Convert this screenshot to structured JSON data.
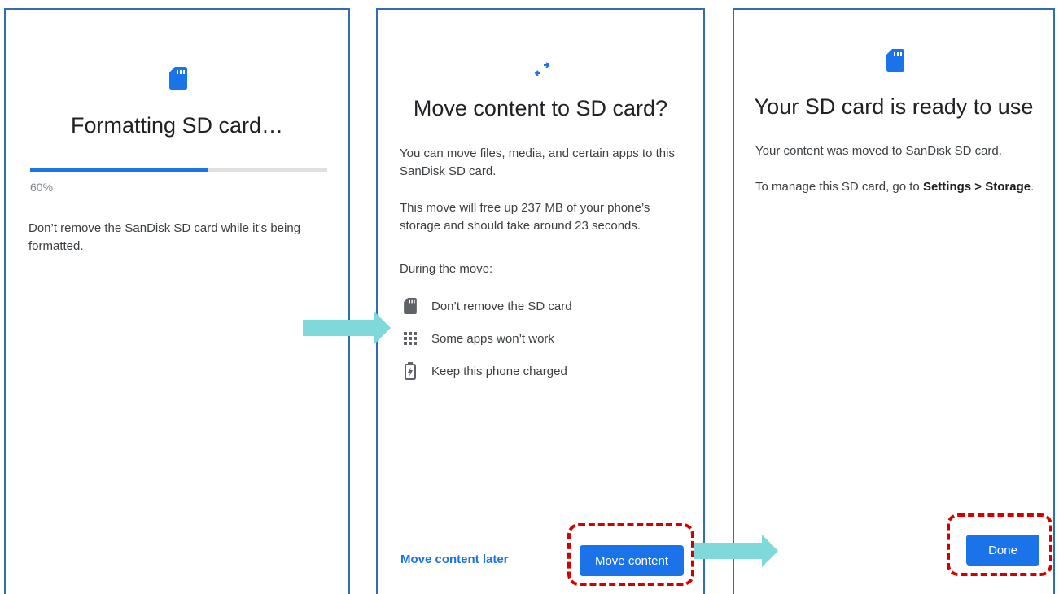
{
  "colors": {
    "accent": "#1a73e8",
    "panel_border": "#2e6fb4",
    "annotation": "#d40000",
    "arrow": "#7fd8d9"
  },
  "screen1": {
    "icon": "sd-card-icon",
    "title": "Formatting SD card…",
    "progress_percent": 60,
    "progress_label": "60%",
    "message": "Don’t remove the SanDisk SD card while it’s being formatted."
  },
  "screen2": {
    "icon": "swap-arrows-icon",
    "title": "Move content to SD card?",
    "intro": "You can move files, media, and certain apps to this SanDisk SD card.",
    "details": "This move will free up 237 MB of your phone’s storage and should take around 23 seconds.",
    "during_label": "During the move:",
    "bullets": [
      {
        "icon": "sd-card-icon",
        "text": "Don’t remove the SD card"
      },
      {
        "icon": "apps-grid-icon",
        "text": "Some apps won’t work"
      },
      {
        "icon": "battery-charging-icon",
        "text": "Keep this phone charged"
      }
    ],
    "later_button": "Move content later",
    "primary_button": "Move content"
  },
  "screen3": {
    "icon": "sd-card-icon",
    "title": "Your SD card is ready to use",
    "message": "Your content was moved to SanDisk SD card.",
    "manage_prefix": "To manage this SD card, go to ",
    "manage_path": "Settings > Storage",
    "manage_suffix": ".",
    "done_button": "Done"
  }
}
